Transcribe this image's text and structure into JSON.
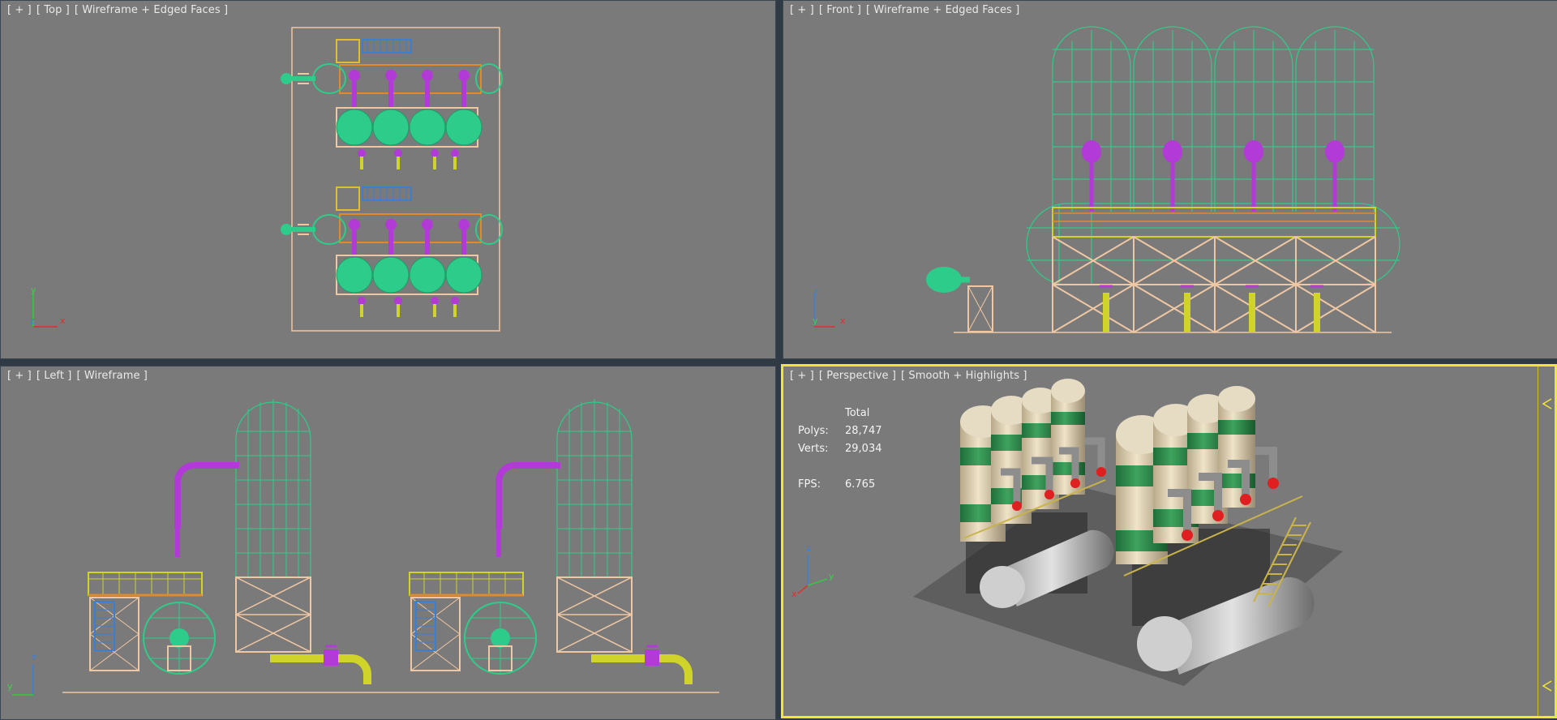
{
  "viewports": {
    "top": {
      "plus": "[ + ]",
      "view": "[ Top ]",
      "mode": "[ Wireframe + Edged Faces ]",
      "axis_a": "y",
      "axis_b": "z",
      "axis_c": "x"
    },
    "front": {
      "plus": "[ + ]",
      "view": "[ Front ]",
      "mode": "[ Wireframe + Edged Faces ]",
      "axis_a": "z",
      "axis_b": "y",
      "axis_c": "x"
    },
    "left": {
      "plus": "[ + ]",
      "view": "[ Left ]",
      "mode": "[ Wireframe ]",
      "axis_a": "z",
      "axis_b": "y",
      "axis_c": "x"
    },
    "perspective": {
      "plus": "[ + ]",
      "view": "[ Perspective ]",
      "mode": "[ Smooth + Highlights ]",
      "axis_a": "z",
      "axis_b": "y",
      "axis_c": "x"
    }
  },
  "stats": {
    "header": "Total",
    "polys_label": "Polys:",
    "polys_value": "28,747",
    "verts_label": "Verts:",
    "verts_value": "29,034",
    "fps_label": "FPS:",
    "fps_value": "6.765"
  },
  "colors": {
    "viewport_bg": "#7a7a7a",
    "active_border": "#f2e633",
    "wire_green": "#2ecc8a",
    "wire_purple": "#b23ad6",
    "wire_peach": "#f0c7a3",
    "wire_yellow": "#cfd32a",
    "wire_blue": "#3c7fd1",
    "wire_orange": "#e08a2a"
  }
}
